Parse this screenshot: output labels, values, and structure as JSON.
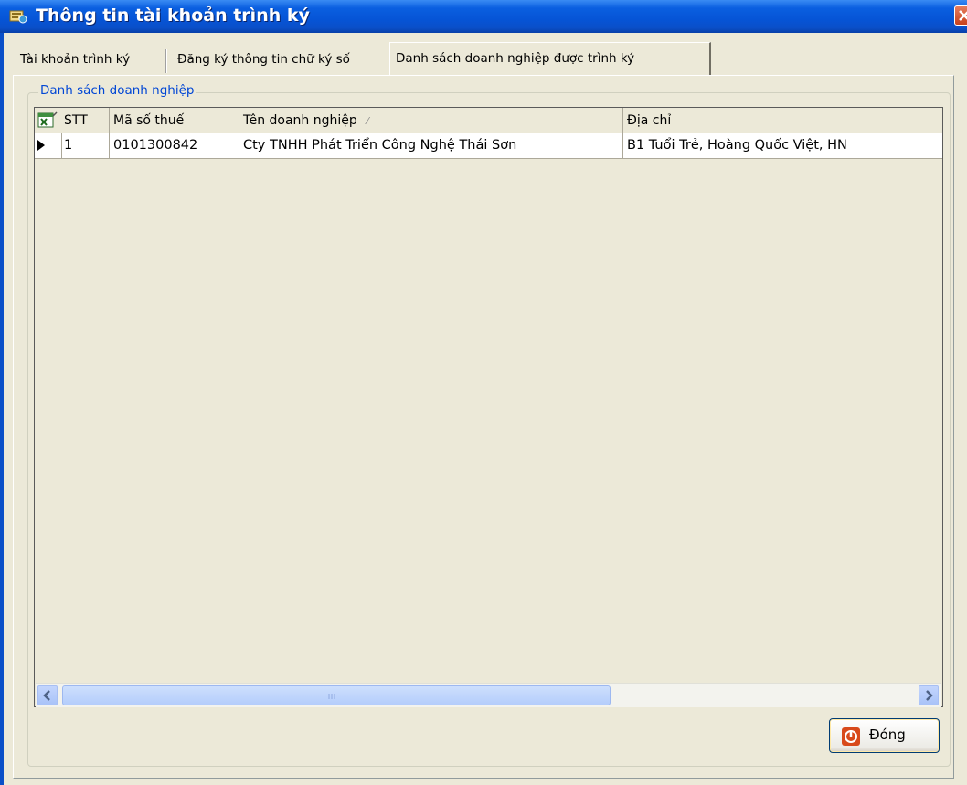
{
  "window": {
    "title": "Thông tin tài khoản trình ký"
  },
  "tabs": [
    {
      "label": "Tài khoản trình ký"
    },
    {
      "label": "Đăng ký thông tin chữ ký số"
    },
    {
      "label": "Danh sách doanh nghiệp được trình ký",
      "active": true
    }
  ],
  "group": {
    "label": "Danh sách doanh nghiệp"
  },
  "grid": {
    "columns": [
      "STT",
      "Mã số thuế",
      "Tên doanh nghiệp",
      "Địa chỉ"
    ],
    "sort_indicator": "⁄",
    "rows": [
      {
        "stt": "1",
        "ma_so_thue": "0101300842",
        "ten_doanh_nghiep": "Cty TNHH Phát Triển Công Nghệ Thái Sơn",
        "dia_chi": "B1 Tuổi Trẻ, Hoàng Quốc Việt, HN"
      }
    ]
  },
  "buttons": {
    "close_label": "Đóng"
  },
  "colors": {
    "titlebar": "#0a5fe0",
    "group_label": "#0046d5",
    "close_icon": "#d84a1b"
  }
}
